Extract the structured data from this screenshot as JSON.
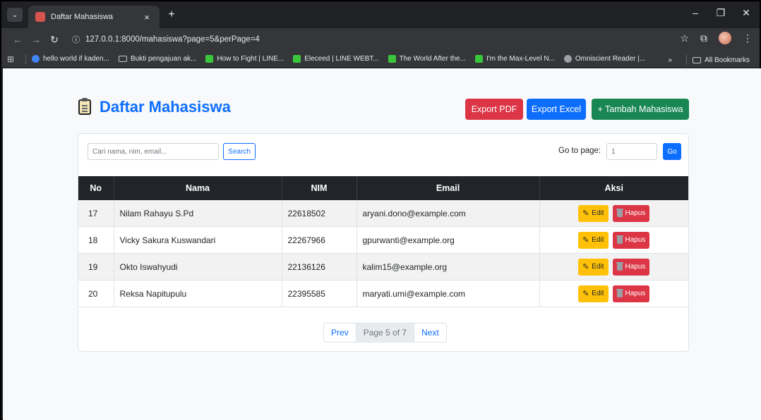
{
  "browser": {
    "tab_title": "Daftar Mahasiswa",
    "url": "127.0.0.1:8000/mahasiswa?page=5&perPage=4",
    "bookmarks": [
      {
        "label": "hello world if kaden...",
        "icon": "google-icon"
      },
      {
        "label": "Bukti pengajuan ak...",
        "icon": "folder-icon"
      },
      {
        "label": "How to Fight | LINE...",
        "icon": "webtoon-icon"
      },
      {
        "label": "Eleceed | LINE WEBT...",
        "icon": "webtoon-icon"
      },
      {
        "label": "The World After the...",
        "icon": "webtoon-icon"
      },
      {
        "label": "I'm the Max-Level N...",
        "icon": "webtoon-icon"
      },
      {
        "label": "Omniscient Reader |...",
        "icon": "globe-icon"
      }
    ],
    "all_bookmarks_label": "All Bookmarks"
  },
  "page": {
    "title": "Daftar Mahasiswa",
    "buttons": {
      "export_pdf": "Export PDF",
      "export_excel": "Export Excel",
      "add": "+ Tambah Mahasiswa"
    },
    "colors": {
      "primary": "#0d6efd",
      "danger": "#dc3545",
      "success": "#198754",
      "warning": "#ffc107",
      "header_dark": "#212529"
    }
  },
  "search": {
    "placeholder": "Cari nama, nim, email...",
    "button": "Search"
  },
  "goto": {
    "label": "Go to page:",
    "value": "1",
    "button": "Go"
  },
  "table": {
    "headers": [
      "No",
      "Nama",
      "NIM",
      "Email",
      "Aksi"
    ],
    "rows": [
      {
        "no": "17",
        "nama": "Nilam Rahayu S.Pd",
        "nim": "22618502",
        "email": "aryani.dono@example.com"
      },
      {
        "no": "18",
        "nama": "Vicky Sakura Kuswandari",
        "nim": "22267966",
        "email": "gpurwanti@example.org"
      },
      {
        "no": "19",
        "nama": "Okto Iswahyudi",
        "nim": "22136126",
        "email": "kalim15@example.org"
      },
      {
        "no": "20",
        "nama": "Reksa Napitupulu",
        "nim": "22395585",
        "email": "maryati.umi@example.com"
      }
    ],
    "edit_label": "Edit",
    "delete_label": "Hapus"
  },
  "pagination": {
    "prev": "Prev",
    "current": "Page 5 of 7",
    "next": "Next"
  }
}
